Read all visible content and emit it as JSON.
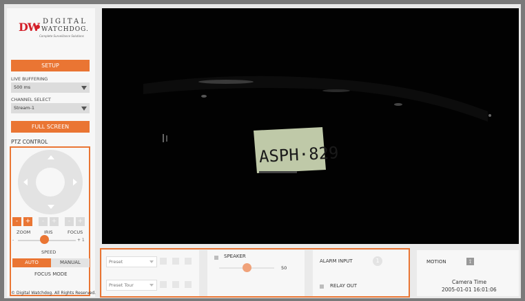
{
  "brand": {
    "mark": "DW",
    "line1": "DIGITAL",
    "line2": "WATCHDOG.",
    "tagline": "Complete Surveillance Solutions"
  },
  "sidebar": {
    "setup_label": "SETUP",
    "live_buffering_label": "LIVE BUFFERING",
    "live_buffering_value": "500 ms",
    "channel_select_label": "CHANNEL SELECT",
    "channel_select_value": "Stream-1",
    "full_screen_label": "FULL SCREEN",
    "ptz_title": "PTZ CONTROL",
    "zoom_out": "-",
    "zoom_in": "+",
    "iris_close": "-",
    "iris_open": "+",
    "focus_near": "-",
    "focus_far": "+",
    "zoom_label": "ZOOM",
    "iris_label": "IRIS",
    "focus_label": "FOCUS",
    "speed_min": "-",
    "speed_max": "+ 1",
    "speed_label": "SPEED",
    "speed_value_fraction": 0.45,
    "focus_auto": "AUTO",
    "focus_manual": "MANUAL",
    "focus_mode_label": "FOCUS MODE",
    "copyright": "© Digital Watchdog. All Rights Reserved."
  },
  "video": {
    "plate_text": "ASPH·829"
  },
  "bottom": {
    "preset_placeholder": "Preset",
    "preset_tour_placeholder": "Preset Tour",
    "speaker_label": "SPEAKER",
    "speaker_value": "50",
    "speaker_fraction": 0.5,
    "alarm_input_label": "ALARM INPUT",
    "alarm_input_index": "1",
    "relay_out_label": "RELAY OUT",
    "motion_label": "MOTION",
    "camera_time_label": "Camera Time",
    "camera_time_value": "2005-01-01 16:01:06"
  },
  "colors": {
    "accent": "#ea7533",
    "frame": "#eaeaea"
  }
}
